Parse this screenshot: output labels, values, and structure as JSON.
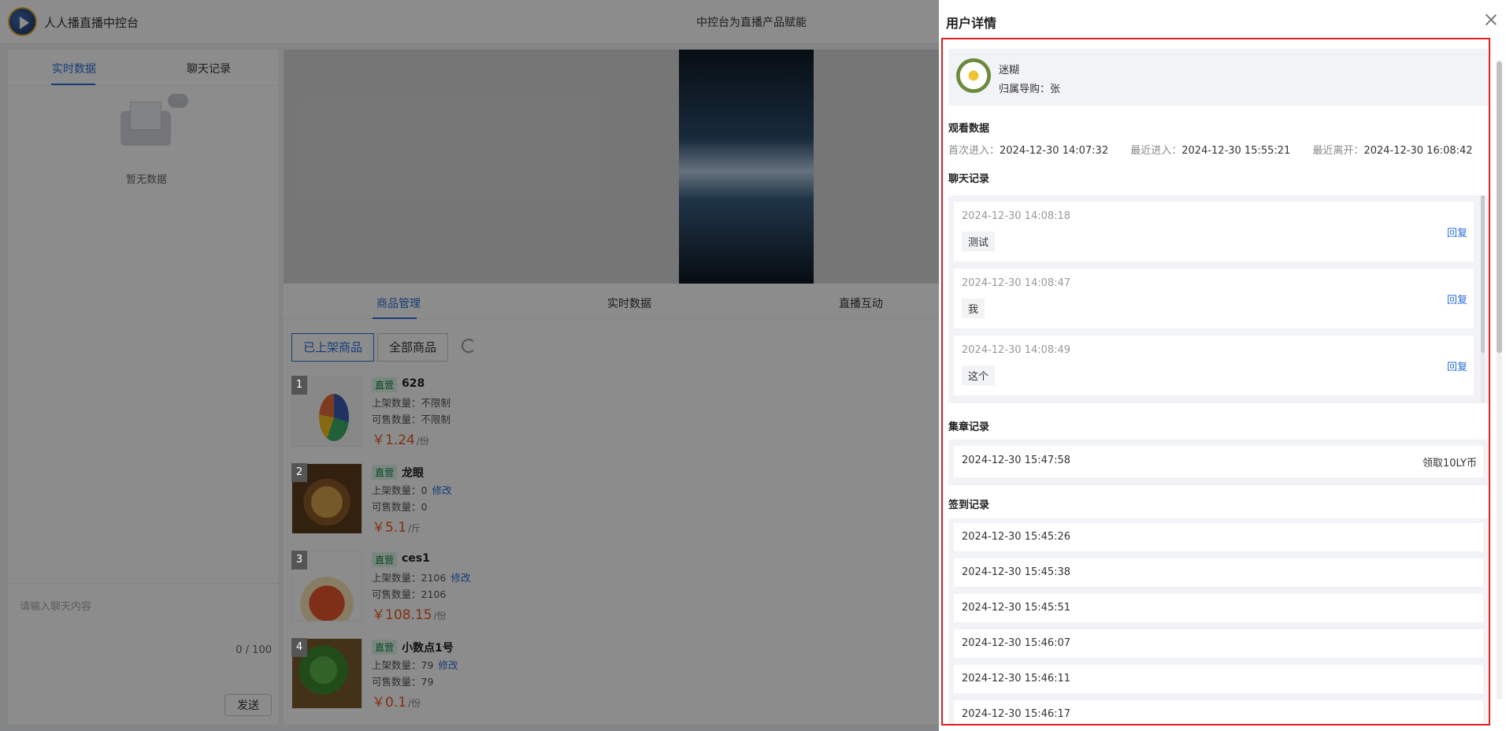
{
  "app": {
    "title": "人人播直播中控台",
    "center_title": "中控台为直播产品赋能"
  },
  "left_panel": {
    "tabs": [
      "实时数据",
      "聊天记录"
    ],
    "empty_text": "暂无数据",
    "chat_placeholder": "请输入聊天内容",
    "char_count": "0 / 100",
    "send_label": "发送"
  },
  "content": {
    "tabs": [
      "商品管理",
      "实时数据",
      "直播互动"
    ],
    "filters": [
      "已上架商品",
      "全部商品"
    ],
    "edit_label": "修改",
    "products": [
      {
        "num": "1",
        "tag": "直营",
        "name": "628",
        "listed": "上架数量：不限制",
        "sellable": "可售数量：不限制",
        "price": "￥1.24",
        "unit": "/份",
        "editable": false
      },
      {
        "num": "2",
        "tag": "直营",
        "name": "龙眼",
        "listed": "上架数量：0",
        "sellable": "可售数量：0",
        "price": "￥5.1",
        "unit": "/斤",
        "editable": true
      },
      {
        "num": "3",
        "tag": "直营",
        "name": "ces1",
        "listed": "上架数量：2106",
        "sellable": "可售数量：2106",
        "price": "￥108.15",
        "unit": "/份",
        "editable": true
      },
      {
        "num": "4",
        "tag": "直营",
        "name": "小数点1号",
        "listed": "上架数量：79",
        "sellable": "可售数量：79",
        "price": "￥0.1",
        "unit": "/份",
        "editable": true
      }
    ]
  },
  "drawer": {
    "title": "用户详情",
    "user": {
      "name": "迷糊",
      "guide": "归属导购：张"
    },
    "watch": {
      "title": "观看数据",
      "first_label": "首次进入：",
      "first_value": "2024-12-30 14:07:32",
      "recent_label": "最近进入：",
      "recent_value": "2024-12-30 15:55:21",
      "leave_label": "最近离开：",
      "leave_value": "2024-12-30 16:08:42"
    },
    "chat": {
      "title": "聊天记录",
      "reply_label": "回复",
      "items": [
        {
          "time": "2024-12-30 14:08:18",
          "msg": "测试"
        },
        {
          "time": "2024-12-30 14:08:47",
          "msg": "我"
        },
        {
          "time": "2024-12-30 14:08:49",
          "msg": "这个"
        }
      ]
    },
    "stamp": {
      "title": "集章记录",
      "time": "2024-12-30 15:47:58",
      "value": "领取10LY币"
    },
    "checkin": {
      "title": "签到记录",
      "items": [
        "2024-12-30 15:45:26",
        "2024-12-30 15:45:38",
        "2024-12-30 15:45:51",
        "2024-12-30 15:46:07",
        "2024-12-30 15:46:11",
        "2024-12-30 15:46:17"
      ]
    }
  }
}
